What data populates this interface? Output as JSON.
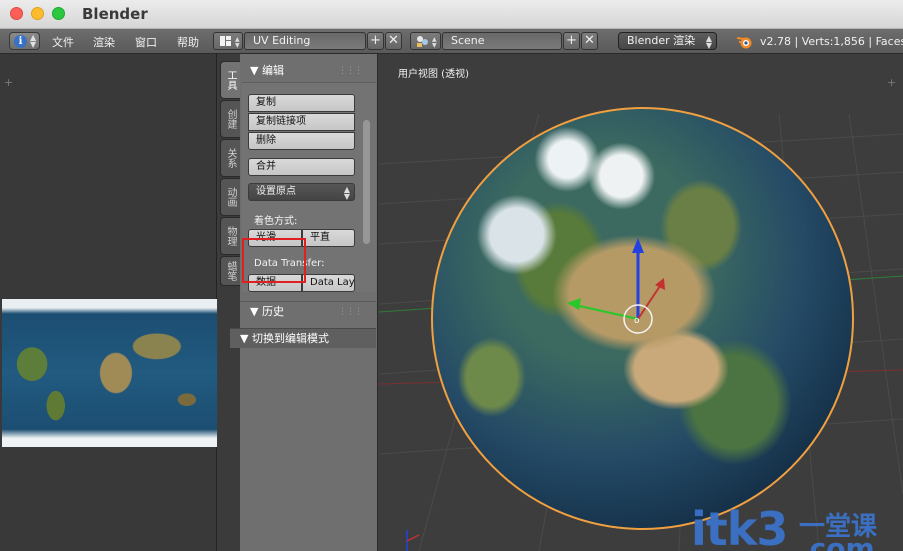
{
  "window": {
    "title": "Blender"
  },
  "header": {
    "menus": [
      "文件",
      "渲染",
      "窗口",
      "帮助"
    ],
    "screen_layout": "UV Editing",
    "scene": "Scene",
    "render_engine": "Blender 渲染",
    "stats": "v2.78 | Verts:1,856 | Faces:"
  },
  "tool_shelf": {
    "tabs": [
      "工具",
      "创建",
      "关系",
      "动画",
      "物理",
      "蜡笔"
    ],
    "active_tab": "工具",
    "edit_panel": {
      "title": "编辑",
      "buttons": [
        "复制",
        "复制链接项",
        "删除",
        "合并"
      ],
      "set_origin": "设置原点",
      "shading_label": "着色方式:",
      "shading_smooth": "光滑",
      "shading_flat": "平直",
      "data_transfer_label": "Data Transfer:",
      "data_btn": "数据",
      "data_layout_btn": "Data Lay"
    },
    "history_panel": {
      "title": "历史"
    },
    "operator_panel": {
      "title": "切换到编辑模式"
    }
  },
  "viewport": {
    "title": "用户视图 (透视)",
    "origin_label": "o"
  },
  "watermark": {
    "brand": "itk3",
    "suffix": "一堂课",
    "domain": ".com"
  },
  "colors": {
    "selection_outline": "#f1a040",
    "highlight_box": "#e02020",
    "axis_z": "#2442e0",
    "axis_x": "#c43030",
    "axis_y": "#28c828"
  },
  "icons": [
    "info-icon",
    "layout-grid-icon",
    "scene-icon",
    "blender-logo-icon",
    "plus-icon",
    "close-icon",
    "triangle-down-icon"
  ]
}
